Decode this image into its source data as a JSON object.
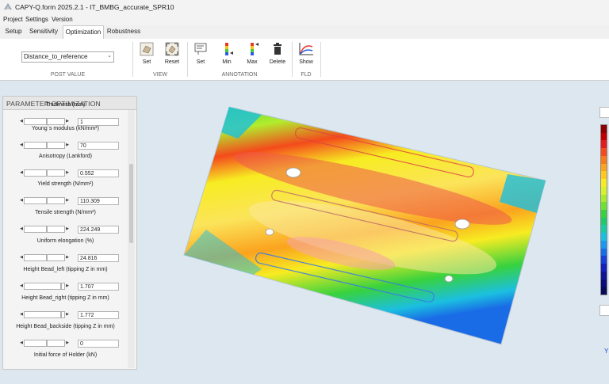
{
  "window": {
    "title": "CAPY-Q.form 2025.2.1 - IT_BMBG_accurate_SPR10"
  },
  "menu": [
    "Project",
    "Settings",
    "Version"
  ],
  "tabs": [
    {
      "label": "Setup"
    },
    {
      "label": "Sensitivity"
    },
    {
      "label": "Optimization",
      "active": true
    },
    {
      "label": "Robustness"
    }
  ],
  "ribbon": {
    "post_value": {
      "selected": "Distance_to_reference",
      "group_label": "POST VALUE"
    },
    "view": {
      "group_label": "VIEW",
      "buttons": [
        {
          "label": "Set",
          "icon": "view-set-icon"
        },
        {
          "label": "Reset",
          "icon": "view-reset-icon"
        }
      ]
    },
    "annotation": {
      "group_label": "ANNOTATION",
      "buttons": [
        {
          "label": "Set",
          "icon": "annotation-set-icon"
        },
        {
          "label": "Min",
          "icon": "min-marker-icon"
        },
        {
          "label": "Max",
          "icon": "max-marker-icon"
        },
        {
          "label": "Delete",
          "icon": "trash-icon"
        }
      ]
    },
    "fld": {
      "group_label": "FLD",
      "buttons": [
        {
          "label": "Show",
          "icon": "fld-show-icon"
        }
      ]
    }
  },
  "panel": {
    "title": "PARAMETER OPTIMIZATION",
    "params": [
      {
        "label": "Thickness (mm)",
        "value": "1",
        "fill": 0.55
      },
      {
        "label": "Young´s modulus (kN/mm²)",
        "value": "70",
        "fill": 0.55
      },
      {
        "label": "Anisotropy (Lankford)",
        "value": "0.552",
        "fill": 0.55
      },
      {
        "label": "Yield strength (N/mm²)",
        "value": "110.309",
        "fill": 0.55
      },
      {
        "label": "Tensile strength (N/mm²)",
        "value": "224.249",
        "fill": 0.55
      },
      {
        "label": "Uniform elongation (%)",
        "value": "24.816",
        "fill": 0.55
      },
      {
        "label": "Height Bead_left (tipping Z in mm)",
        "value": "1.707",
        "fill": 0.9
      },
      {
        "label": "Height Bead_right (tipping Z in mm)",
        "value": "1.772",
        "fill": 0.9
      },
      {
        "label": "Height Bead_backside (tipping Z in mm)",
        "value": "0",
        "fill": 0.55
      },
      {
        "label": "Initial force of Holder (kN)",
        "value": "",
        "fill": 0.55
      }
    ]
  },
  "viewport": {
    "axis_label": "Y"
  },
  "colors": {
    "background": "#dde7ef",
    "colorbar": [
      "#8b0000",
      "#c00000",
      "#e21c1c",
      "#f24b1e",
      "#f77a1d",
      "#fba31f",
      "#fdc91e",
      "#f7ec22",
      "#d7f12a",
      "#a6ec2c",
      "#6fe133",
      "#38d23e",
      "#1fc96a",
      "#1ac9a6",
      "#1bbfe0",
      "#1a97ef",
      "#1a6be6",
      "#1a3fd6",
      "#1420b8",
      "#0e1496",
      "#0a0e78",
      "#070a5a"
    ]
  }
}
